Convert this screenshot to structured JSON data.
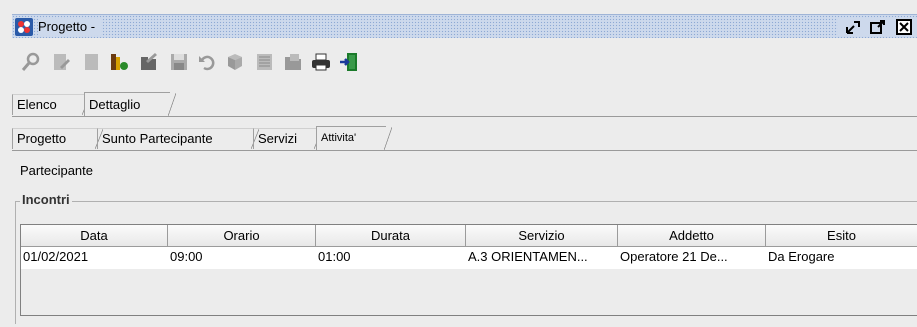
{
  "window": {
    "title": "Progetto -",
    "buttons": [
      "minimize-icon",
      "maximize-icon",
      "close-icon"
    ]
  },
  "toolbar": {
    "icons": [
      "search-icon",
      "edit-icon",
      "new-document-icon",
      "users-icon",
      "folder-edit-icon",
      "save-icon",
      "undo-icon",
      "help-icon",
      "export-icon",
      "folder-icon",
      "print-icon",
      "exit-icon"
    ]
  },
  "tabs_main": [
    {
      "label": "Elenco",
      "selected": false
    },
    {
      "label": "Dettaglio",
      "selected": true
    }
  ],
  "tabs_sub": [
    {
      "label": "Progetto",
      "selected": false
    },
    {
      "label": "Sunto Partecipante",
      "selected": false
    },
    {
      "label": "Servizi",
      "selected": false
    },
    {
      "label": "Attivita'",
      "selected": true
    }
  ],
  "section": {
    "label": "Partecipante"
  },
  "incontri": {
    "legend": "Incontri",
    "columns": [
      "Data",
      "Orario",
      "Durata",
      "Servizio",
      "Addetto",
      "Esito"
    ],
    "rows": [
      [
        "01/02/2021",
        "09:00",
        "01:00",
        "A.3 ORIENTAMEN...",
        "Operatore 21 De...",
        "Da Erogare"
      ]
    ]
  },
  "colors": {
    "titlebar": "#cdd9ec",
    "background": "#ececec",
    "table_row": "#ffffff"
  }
}
